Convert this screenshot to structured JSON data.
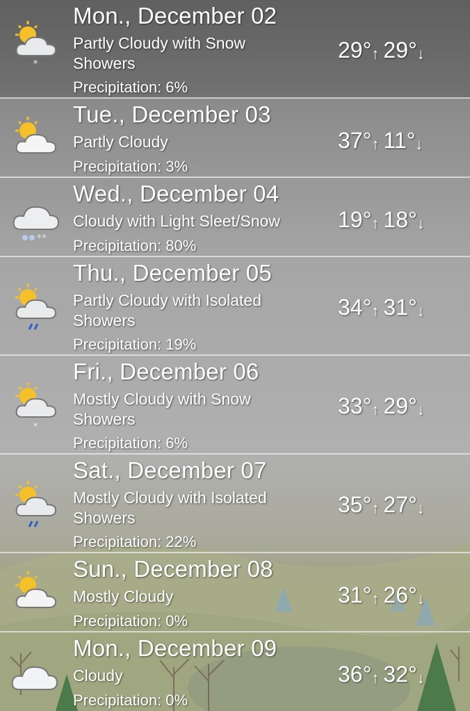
{
  "forecast": [
    {
      "day": "Mon., December 02",
      "condition": "Partly Cloudy with Snow Showers",
      "precip": "Precipitation: 6%",
      "high": "29°",
      "low": "29°",
      "icon": "partly-cloudy-snow-icon"
    },
    {
      "day": "Tue., December 03",
      "condition": "Partly Cloudy",
      "precip": "Precipitation: 3%",
      "high": "37°",
      "low": "11°",
      "icon": "partly-cloudy-icon"
    },
    {
      "day": "Wed., December 04",
      "condition": "Cloudy with Light Sleet/Snow",
      "precip": "Precipitation: 80%",
      "high": "19°",
      "low": "18°",
      "icon": "cloudy-sleet-icon"
    },
    {
      "day": "Thu., December 05",
      "condition": "Partly Cloudy with Isolated Showers",
      "precip": "Precipitation: 19%",
      "high": "34°",
      "low": "31°",
      "icon": "partly-cloudy-rain-icon"
    },
    {
      "day": "Fri., December 06",
      "condition": "Mostly Cloudy with Snow Showers",
      "precip": "Precipitation: 6%",
      "high": "33°",
      "low": "29°",
      "icon": "mostly-cloudy-snow-icon"
    },
    {
      "day": "Sat., December 07",
      "condition": "Mostly Cloudy with Isolated Showers",
      "precip": "Precipitation: 22%",
      "high": "35°",
      "low": "27°",
      "icon": "mostly-cloudy-rain-icon"
    },
    {
      "day": "Sun., December 08",
      "condition": "Mostly Cloudy",
      "precip": "Precipitation: 0%",
      "high": "31°",
      "low": "26°",
      "icon": "mostly-cloudy-icon"
    },
    {
      "day": "Mon., December 09",
      "condition": "Cloudy",
      "precip": "Precipitation: 0%",
      "high": "36°",
      "low": "32°",
      "icon": "cloudy-icon"
    }
  ],
  "arrows": {
    "up": "↑",
    "down": "↓"
  }
}
